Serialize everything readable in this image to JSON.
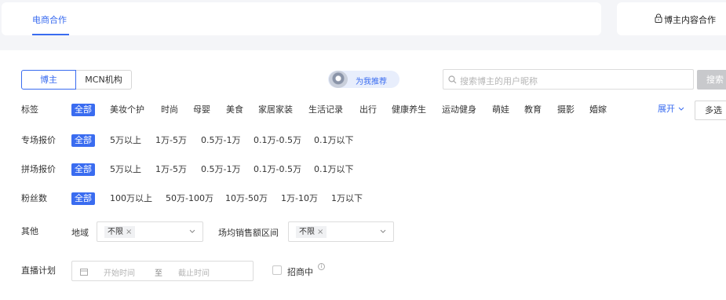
{
  "top_tab": "电商合作",
  "top_right_label": "博主内容合作",
  "segment": [
    "博主",
    "MCN机构"
  ],
  "recommend_label": "为我推荐",
  "search": {
    "placeholder": "搜索博主的用户昵称",
    "button": "搜索"
  },
  "filters": {
    "tags": {
      "label": "标签",
      "options": [
        "全部",
        "美妆个护",
        "时尚",
        "母婴",
        "美食",
        "家居家装",
        "生活记录",
        "出行",
        "健康养生",
        "运动健身",
        "萌娃",
        "教育",
        "摄影",
        "婚嫁"
      ],
      "selected": "全部"
    },
    "special_price": {
      "label": "专场报价",
      "options": [
        "全部",
        "5万以上",
        "1万-5万",
        "0.5万-1万",
        "0.1万-0.5万",
        "0.1万以下"
      ],
      "selected": "全部"
    },
    "group_price": {
      "label": "拼场报价",
      "options": [
        "全部",
        "5万以上",
        "1万-5万",
        "0.5万-1万",
        "0.1万-0.5万",
        "0.1万以下"
      ],
      "selected": "全部"
    },
    "fans": {
      "label": "粉丝数",
      "options": [
        "全部",
        "100万以上",
        "50万-100万",
        "10万-50万",
        "1万-10万",
        "1万以下"
      ],
      "selected": "全部"
    }
  },
  "expand_label": "展开",
  "multi_label": "多选",
  "other": {
    "label": "其他",
    "region_label": "地域",
    "region_value": "不限",
    "sales_label": "场均销售额区间",
    "sales_value": "不限"
  },
  "live_plan": {
    "label": "直播计划",
    "start_placeholder": "开始时间",
    "separator": "至",
    "end_placeholder": "截止时间",
    "checkbox_label": "招商中",
    "info_icon": "i"
  },
  "colors": {
    "accent": "#3a6cf0",
    "search_button": "#c8c9cc"
  }
}
